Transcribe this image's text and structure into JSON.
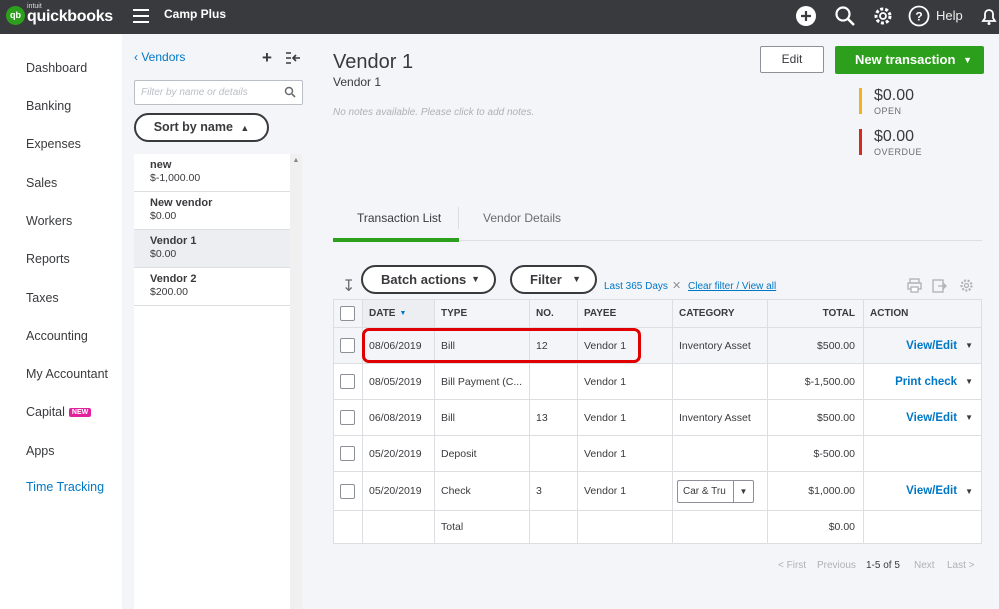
{
  "topbar": {
    "logo_badge": "qb",
    "logo_small": "intuit",
    "logo_text": "quickbooks",
    "company": "Camp Plus",
    "help_label": "Help",
    "icons": [
      "plus-circle-icon",
      "search-icon",
      "gear-icon",
      "help-icon",
      "bell-icon"
    ]
  },
  "sidebar": {
    "items": [
      {
        "label": "Dashboard"
      },
      {
        "label": "Banking"
      },
      {
        "label": "Expenses"
      },
      {
        "label": "Sales"
      },
      {
        "label": "Workers"
      },
      {
        "label": "Reports"
      },
      {
        "label": "Taxes"
      },
      {
        "label": "Accounting"
      },
      {
        "label": "My Accountant"
      },
      {
        "label": "Capital",
        "badge": "NEW"
      },
      {
        "label": "Apps"
      },
      {
        "label": "Time Tracking"
      }
    ]
  },
  "vendor_panel": {
    "back_label": "Vendors",
    "filter_placeholder": "Filter by name or details",
    "sort_label": "Sort by name",
    "vendors": [
      {
        "name": "new",
        "amount": "$-1,000.00"
      },
      {
        "name": "New vendor",
        "amount": "$0.00"
      },
      {
        "name": "Vendor 1",
        "amount": "$0.00"
      },
      {
        "name": "Vendor 2",
        "amount": "$200.00"
      }
    ]
  },
  "header": {
    "title": "Vendor 1",
    "subtitle": "Vendor 1",
    "notes": "No notes available. Please click to add notes.",
    "edit_label": "Edit",
    "new_transaction_label": "New transaction"
  },
  "stats": {
    "open": {
      "amount": "$0.00",
      "label": "OPEN",
      "color": "#f2b21b"
    },
    "overdue": {
      "amount": "$0.00",
      "label": "OVERDUE",
      "color": "#d52b1e"
    }
  },
  "tabs": [
    {
      "label": "Transaction List"
    },
    {
      "label": "Vendor Details"
    }
  ],
  "toolbar": {
    "batch_label": "Batch actions",
    "filter_label": "Filter",
    "range_label": "Last 365 Days",
    "clear_label": "Clear filter / View all"
  },
  "table": {
    "columns": [
      "DATE",
      "TYPE",
      "NO.",
      "PAYEE",
      "CATEGORY",
      "TOTAL",
      "ACTION"
    ],
    "rows": [
      {
        "date": "08/06/2019",
        "type": "Bill",
        "no": "12",
        "payee": "Vendor 1",
        "category": "Inventory Asset",
        "total": "$500.00",
        "action": "View/Edit"
      },
      {
        "date": "08/05/2019",
        "type": "Bill Payment (C...",
        "no": "",
        "payee": "Vendor 1",
        "category": "",
        "total": "$-1,500.00",
        "action": "Print check"
      },
      {
        "date": "06/08/2019",
        "type": "Bill",
        "no": "13",
        "payee": "Vendor 1",
        "category": "Inventory Asset",
        "total": "$500.00",
        "action": "View/Edit"
      },
      {
        "date": "05/20/2019",
        "type": "Deposit",
        "no": "",
        "payee": "Vendor 1",
        "category": "",
        "total": "$-500.00",
        "action": ""
      },
      {
        "date": "05/20/2019",
        "type": "Check",
        "no": "3",
        "payee": "Vendor 1",
        "category_select": "Car & Tru",
        "total": "$1,000.00",
        "action": "View/Edit"
      }
    ],
    "total_label": "Total",
    "total_value": "$0.00"
  },
  "pager": {
    "first": "< First",
    "previous": "Previous",
    "range": "1-5 of 5",
    "next": "Next",
    "last": "Last >"
  }
}
